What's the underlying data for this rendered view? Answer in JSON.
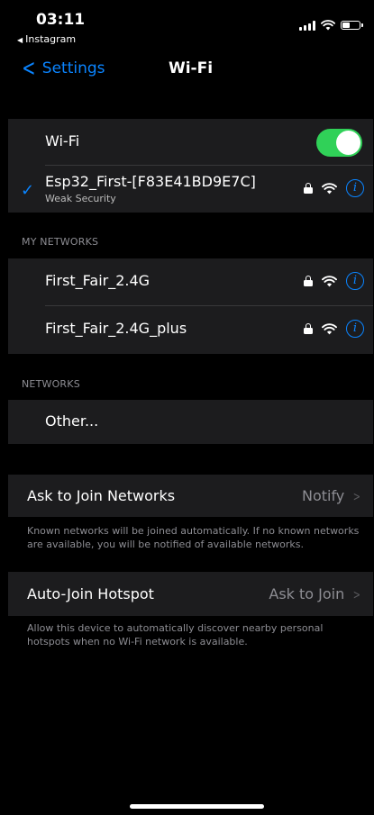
{
  "status_bar": {
    "time": "03:11",
    "back_app": "Instagram"
  },
  "nav": {
    "back_label": "Settings",
    "title": "Wi-Fi"
  },
  "wifi": {
    "toggle_label": "Wi-Fi",
    "toggle_on": true,
    "connected": {
      "name": "Esp32_First-[F83E41BD9E7C]",
      "subtitle": "Weak Security"
    }
  },
  "my_networks": {
    "header": "MY NETWORKS",
    "items": [
      {
        "name": "First_Fair_2.4G"
      },
      {
        "name": "First_Fair_2.4G_plus"
      }
    ]
  },
  "networks": {
    "header": "NETWORKS",
    "other_label": "Other..."
  },
  "ask_to_join": {
    "label": "Ask to Join Networks",
    "value": "Notify",
    "footer": "Known networks will be joined automatically. If no known networks are available, you will be notified of available networks."
  },
  "auto_join": {
    "label": "Auto-Join Hotspot",
    "value": "Ask to Join",
    "footer": "Allow this device to automatically discover nearby personal hotspots when no Wi-Fi network is available."
  },
  "colors": {
    "accent": "#0a84ff",
    "toggle_on": "#30d158",
    "cell": "#1c1c1e",
    "secondary_text": "#8d8d93"
  },
  "icons": {
    "lock": "lock-icon",
    "wifi": "wifi-icon",
    "info": "info-icon",
    "check": "checkmark-icon"
  }
}
